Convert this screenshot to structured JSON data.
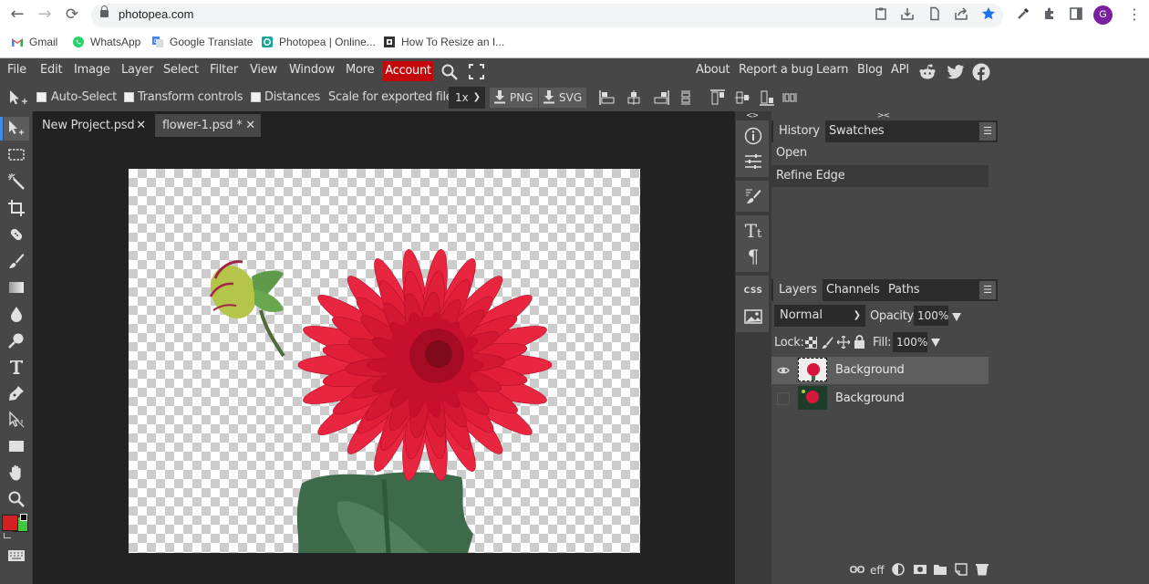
{
  "browser": {
    "url": "photopea.com",
    "nav": {
      "back": "←",
      "forward": "→",
      "reload": "⟳"
    },
    "bookmarks": [
      {
        "label": "Gmail",
        "icon": "gmail-icon",
        "color": "#ea4335"
      },
      {
        "label": "WhatsApp",
        "icon": "whatsapp-icon",
        "color": "#25d366"
      },
      {
        "label": "Google Translate",
        "icon": "google-translate-icon",
        "color": "#4285f4"
      },
      {
        "label": "Photopea | Online...",
        "icon": "photopea-icon",
        "color": "#18a497"
      },
      {
        "label": "How To Resize an I...",
        "icon": "page-icon",
        "color": "#333333"
      }
    ],
    "extensions": [
      "clipboard-icon",
      "download-icon",
      "document-icon",
      "share-icon",
      "bookmark-star-icon",
      "eyedropper-icon",
      "puzzle-icon",
      "sidepanel-icon"
    ],
    "avatar_letter": "G",
    "avatar_color": "#7b1fa2",
    "star_color": "#1a73e8"
  },
  "menu": {
    "items": [
      "File",
      "Edit",
      "Image",
      "Layer",
      "Select",
      "Filter",
      "View",
      "Window",
      "More"
    ],
    "account": "Account",
    "account_color": "#c3070b",
    "right_links": [
      "About",
      "Report a bug",
      "Learn",
      "Blog",
      "API"
    ],
    "social": [
      "reddit-icon",
      "twitter-icon",
      "facebook-icon"
    ]
  },
  "options": {
    "auto_select": "Auto-Select",
    "transform_controls": "Transform controls",
    "distances": "Distances",
    "scale_label": "Scale for exported files:",
    "scale_value": "1x",
    "png": "PNG",
    "svg": "SVG"
  },
  "tools": [
    "move-tool",
    "marquee-tool",
    "magic-wand-tool",
    "crop-tool",
    "healing-tool",
    "brush-tool",
    "gradient-tool",
    "blur-tool",
    "dodge-tool",
    "type-tool",
    "pen-tool",
    "path-select-tool",
    "shape-tool",
    "hand-tool",
    "zoom-tool"
  ],
  "colors": {
    "foreground": "#d42020",
    "background": "#3ec83e"
  },
  "documents": [
    {
      "name": "New Project.psd",
      "active": false
    },
    {
      "name": "flower-1.psd *",
      "active": true
    }
  ],
  "history": {
    "tabs": [
      "History",
      "Swatches"
    ],
    "items": [
      "Open",
      "Refine Edge"
    ]
  },
  "layers": {
    "tabs": [
      "Layers",
      "Channels",
      "Paths"
    ],
    "blend_mode": "Normal",
    "opacity_label": "Opacity:",
    "opacity": "100%",
    "lock_label": "Lock:",
    "fill_label": "Fill:",
    "fill": "100%",
    "items": [
      {
        "name": "Background",
        "visible": true,
        "selected": true
      },
      {
        "name": "Background",
        "visible": false,
        "selected": false
      }
    ]
  },
  "side_icons": [
    "info-icon",
    "adjustments-icon",
    "brush-settings-icon",
    "character-icon",
    "paragraph-icon",
    "css-icon",
    "image-icon"
  ],
  "css_label": "CSS",
  "collapse": {
    "left": "<>",
    "right": "><"
  }
}
